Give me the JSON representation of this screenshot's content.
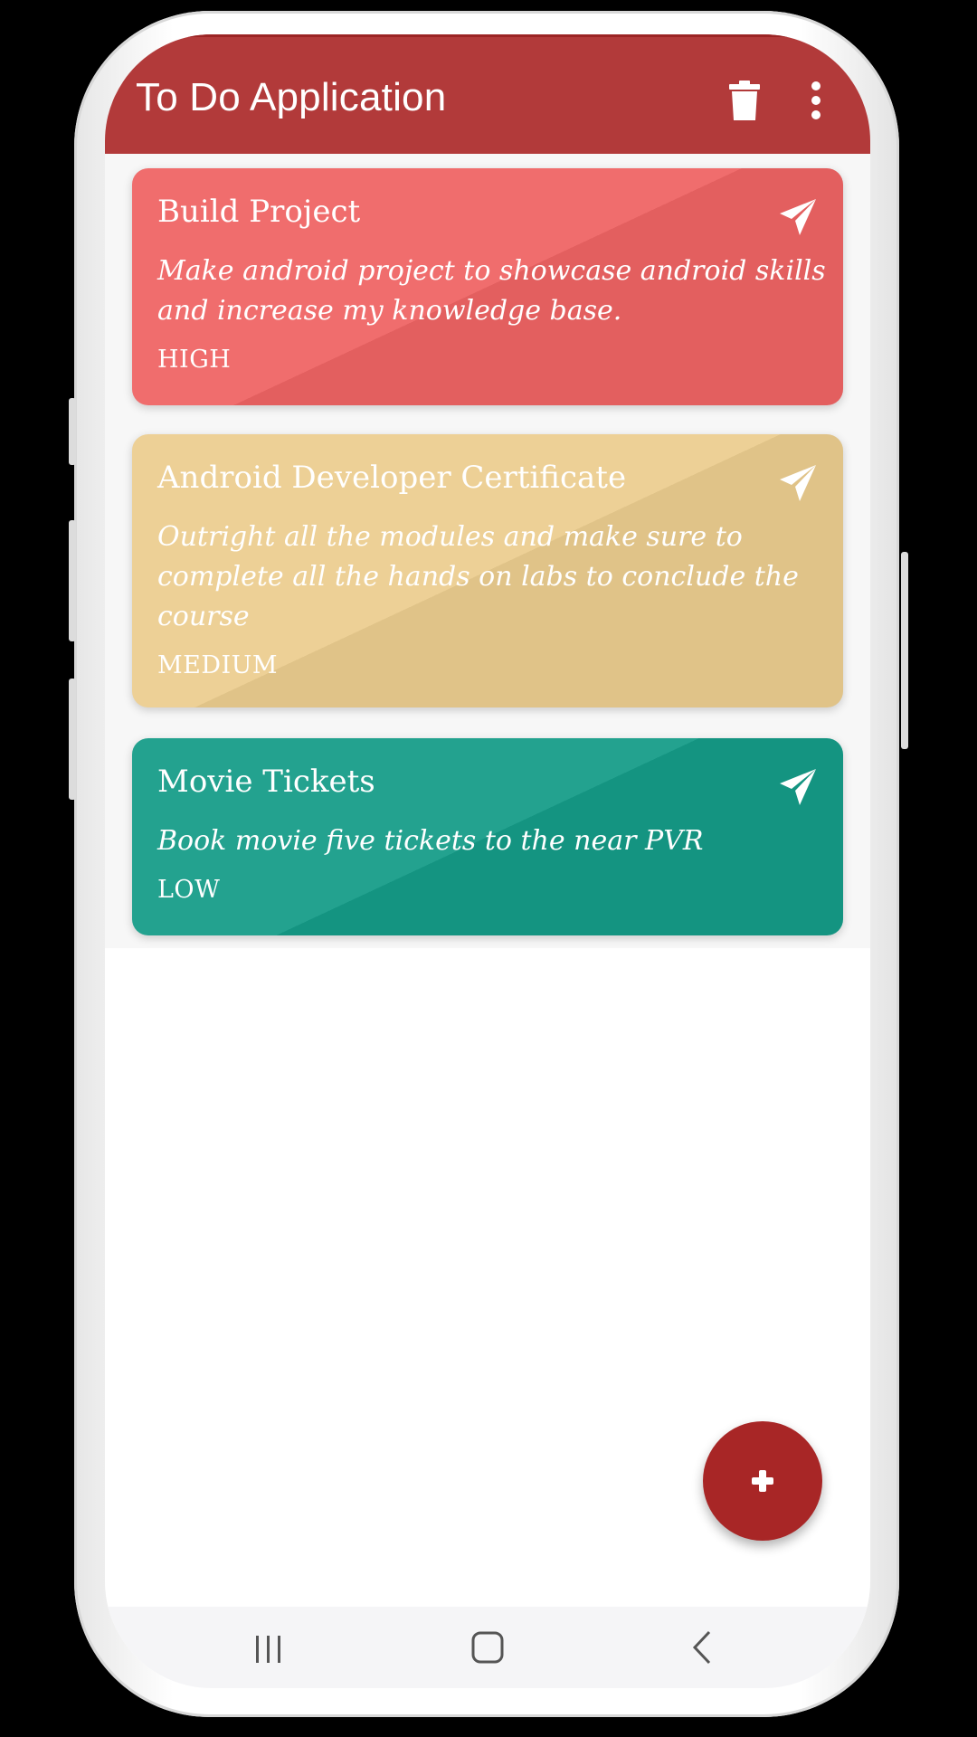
{
  "appbar": {
    "title": "To Do Application",
    "actions": [
      {
        "icon": "trash-icon"
      },
      {
        "icon": "more-vert-icon"
      }
    ]
  },
  "todos": [
    {
      "title": "Build Project",
      "description": "Make android project to showcase android skills and increase my knowledge base.",
      "priority": "HIGH",
      "color": "#ef6464",
      "icon": "send-icon"
    },
    {
      "title": "Android Developer Certificate",
      "description": "Outright  all the modules and make sure to complete all the hands on labs to conclude the course",
      "priority": "MEDIUM",
      "color": "#eccd8f",
      "icon": "send-icon"
    },
    {
      "title": "Movie Tickets",
      "description": "Book movie five tickets to the near PVR",
      "priority": "LOW",
      "color": "#159c88",
      "icon": "send-icon"
    }
  ],
  "fab": {
    "icon": "plus-icon",
    "color": "#a82626"
  },
  "system_nav": [
    {
      "icon": "recents-icon"
    },
    {
      "icon": "home-icon"
    },
    {
      "icon": "back-icon"
    }
  ],
  "colors": {
    "appbar": "#b23a3a",
    "background": "#ffffff"
  }
}
